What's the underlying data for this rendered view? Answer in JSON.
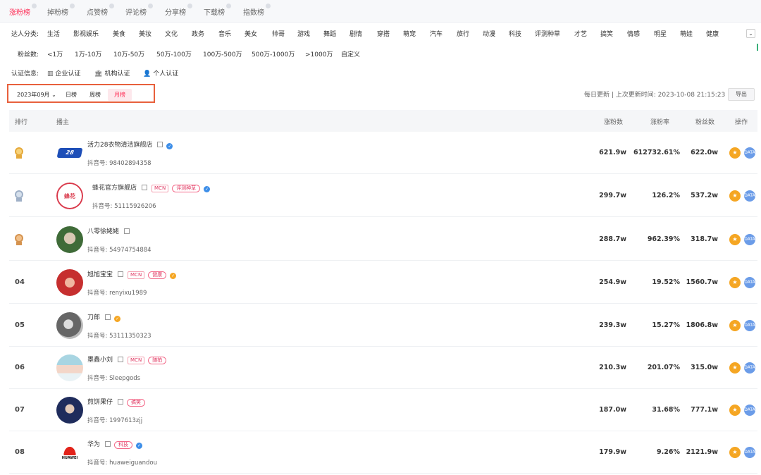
{
  "tabs": [
    {
      "label": "涨粉榜",
      "active": true
    },
    {
      "label": "掉粉榜"
    },
    {
      "label": "点赞榜"
    },
    {
      "label": "评论榜"
    },
    {
      "label": "分享榜"
    },
    {
      "label": "下载榜"
    },
    {
      "label": "指数榜"
    }
  ],
  "filters": {
    "category_label": "达人分类:",
    "categories": [
      "生活",
      "影视娱乐",
      "美食",
      "美妆",
      "文化",
      "政务",
      "音乐",
      "美女",
      "帅哥",
      "游戏",
      "舞蹈",
      "剧情",
      "穿搭",
      "萌宠",
      "汽车",
      "旅行",
      "动漫",
      "科技",
      "评测种草",
      "才艺",
      "搞笑",
      "情感",
      "明星",
      "萌娃",
      "健康"
    ],
    "expand_icon": "chevron-down-icon",
    "fans_label": "粉丝数:",
    "fans_ranges": [
      "<1万",
      "1万-10万",
      "10万-50万",
      "50万-100万",
      "100万-500万",
      "500万-1000万",
      ">1000万",
      "自定义"
    ],
    "cert_label": "认证信息:",
    "certs": [
      {
        "label": "企业认证",
        "icon": "building-icon"
      },
      {
        "label": "机构认证",
        "icon": "institution-icon"
      },
      {
        "label": "个人认证",
        "icon": "person-icon"
      }
    ]
  },
  "period": {
    "month": "2023年09月",
    "options": [
      {
        "label": "日榜"
      },
      {
        "label": "周榜"
      },
      {
        "label": "月榜",
        "active": true
      }
    ]
  },
  "update_info": "每日更新 | 上次更新时间: 2023-10-08 21:15:23",
  "export_label": "导出",
  "table": {
    "headers": {
      "rank": "排行",
      "owner": "播主",
      "gain": "涨粉数",
      "rate": "涨粉率",
      "fans": "粉丝数",
      "ops": "操作"
    },
    "douyin_prefix": "抖音号:",
    "rows": [
      {
        "rank": "1",
        "medal": "gold",
        "name": "活力28衣物清洁旗舰店",
        "douyin_id": "98402894358",
        "verified": "blue",
        "gain": "621.9w",
        "rate": "612732.61%",
        "fans": "622.0w",
        "avatar": "logo-huoli28"
      },
      {
        "rank": "2",
        "medal": "silver",
        "name": "蜂花官方旗舰店",
        "douyin_id": "51115926206",
        "mcn": "MCN",
        "tag": "评测种草",
        "verified": "blue",
        "gain": "299.7w",
        "rate": "126.2%",
        "fans": "537.2w",
        "avatar": "logo-fenghua",
        "avatar_text": "蜂花"
      },
      {
        "rank": "3",
        "medal": "bronze",
        "name": "八零徐姥姥",
        "douyin_id": "54974754884",
        "gain": "288.7w",
        "rate": "962.39%",
        "fans": "318.7w",
        "avatar": "photo-elder"
      },
      {
        "rank": "04",
        "name": "旭旭宝宝",
        "douyin_id": "renyixu1989",
        "mcn": "MCN",
        "tag": "健康",
        "verified": "gold",
        "gain": "254.9w",
        "rate": "19.52%",
        "fans": "1560.7w",
        "avatar": "photo-red"
      },
      {
        "rank": "05",
        "name": "刀郎",
        "douyin_id": "53111350323",
        "verified": "gold",
        "gain": "239.3w",
        "rate": "15.27%",
        "fans": "1806.8w",
        "avatar": "photo-bw"
      },
      {
        "rank": "06",
        "name": "墨鑫小刘",
        "douyin_id": "Sleepgods",
        "mcn": "MCN",
        "tag": "随拍",
        "gain": "210.3w",
        "rate": "201.07%",
        "fans": "315.0w",
        "avatar": "photo-girl"
      },
      {
        "rank": "07",
        "name": "煎饼果仔",
        "douyin_id": "1997613zjj",
        "tag": "搞笑",
        "gain": "187.0w",
        "rate": "31.68%",
        "fans": "777.1w",
        "avatar": "photo-dark"
      },
      {
        "rank": "08",
        "name": "华为",
        "douyin_id": "huaweiguandou",
        "tag": "科技",
        "verified": "blue",
        "gain": "179.9w",
        "rate": "9.26%",
        "fans": "2121.9w",
        "avatar": "logo-huawei",
        "avatar_text": "HUAWEI"
      }
    ],
    "op_icons": {
      "star": "star-icon",
      "data": "data-icon"
    },
    "op_data_label": "DATA"
  },
  "colors": {
    "accent": "#fe2c55",
    "gold_badge": "#f5a623",
    "blue_badge": "#3d8ee8",
    "highlight_border": "#e8603c"
  }
}
